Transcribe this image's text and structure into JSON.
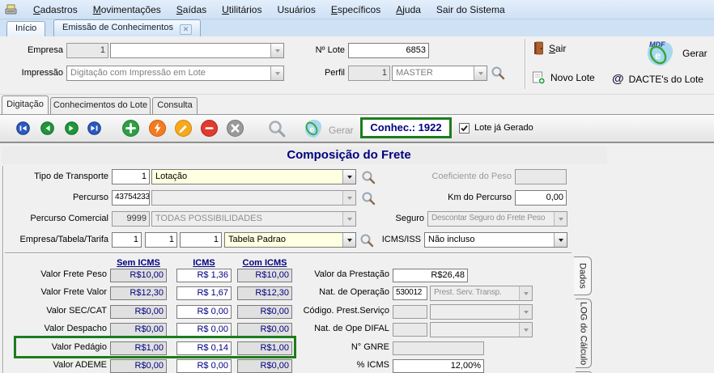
{
  "menubar": {
    "items": [
      "Cadastros",
      "Movimentações",
      "Saídas",
      "Utilitários",
      "Usuários",
      "Específicos",
      "Ajuda",
      "Sair do Sistema"
    ]
  },
  "tabs": {
    "inicio": "Início",
    "emissao": "Emissão de Conhecimentos",
    "close_glyph": "✕"
  },
  "header": {
    "empresa_label": "Empresa",
    "empresa_code": "1",
    "empresa_name": "",
    "impressao_label": "Impressão",
    "impressao_value": "Digitação com Impressão em Lote",
    "lote_label": "Nº Lote",
    "lote_value": "6853",
    "perfil_label": "Perfil",
    "perfil_code": "1",
    "perfil_value": "MASTER",
    "sair_label": "Sair",
    "novo_lote_label": "Novo Lote",
    "gerar_label": "Gerar",
    "dacte_label": "DACTE's do Lote",
    "dacte_glyph": "@"
  },
  "subtabs": {
    "digitacao": "Digitação",
    "conhecimentos": "Conhecimentos do Lote",
    "consulta": "Consulta"
  },
  "toolbar": {
    "icons": [
      "first-record",
      "previous-record",
      "next-record",
      "last-record",
      "add",
      "generate-bolt",
      "edit",
      "delete",
      "cancel",
      "search",
      "cte-logo"
    ],
    "gerar_label": "Gerar",
    "conhec_value": "Conhec.: 1922",
    "lote_gerado_label": "Lote já Gerado",
    "lote_gerado_checked": true
  },
  "freight": {
    "title": "Composição do Frete",
    "tipo_transporte_label": "Tipo de Transporte",
    "tipo_transporte_code": "1",
    "tipo_transporte_value": "Lotação",
    "percurso_label": "Percurso",
    "percurso_code": "43754233",
    "percurso_value": "",
    "percurso_comercial_label": "Percurso Comercial",
    "percurso_comercial_code": "9999",
    "percurso_comercial_value": "TODAS POSSIBILIDADES",
    "ett_label": "Empresa/Tabela/Tarifa",
    "ett_empresa": "1",
    "ett_tabela": "1",
    "ett_tarifa": "1",
    "ett_value": "Tabela Padrao",
    "coeficiente_label": "Coeficiente do Peso",
    "coeficiente_value": "",
    "km_label": "Km do Percurso",
    "km_value": "0,00",
    "seguro_label": "Seguro",
    "seguro_value": "Descontar Seguro do Frete Peso",
    "icms_iss_label": "ICMS/ISS",
    "icms_iss_value": "Não incluso"
  },
  "values_table": {
    "columns": [
      "Sem ICMS",
      "ICMS",
      "Com ICMS"
    ],
    "rows": [
      {
        "label": "Valor Frete Peso",
        "sem": "R$10,00",
        "icms": "R$ 1,36",
        "com": "R$10,00"
      },
      {
        "label": "Valor Frete Valor",
        "sem": "R$12,30",
        "icms": "R$ 1,67",
        "com": "R$12,30"
      },
      {
        "label": "Valor SEC/CAT",
        "sem": "R$0,00",
        "icms": "R$ 0,00",
        "com": "R$0,00"
      },
      {
        "label": "Valor Despacho",
        "sem": "R$0,00",
        "icms": "R$ 0,00",
        "com": "R$0,00"
      },
      {
        "label": "Valor Pedágio",
        "sem": "R$1,00",
        "icms": "R$ 0,14",
        "com": "R$1,00",
        "highlighted": true
      },
      {
        "label": "Valor ADEME",
        "sem": "R$0,00",
        "icms": "R$ 0,00",
        "com": "R$0,00"
      }
    ]
  },
  "totals": {
    "prestacao_label": "Valor da Prestação",
    "prestacao_value": "R$26,48",
    "nat_operacao_label": "Nat. de Operação",
    "nat_operacao_code": "530012",
    "nat_operacao_value": "Prest. Serv. Transp.",
    "codigo_prest_label": "Código. Prest.Serviço",
    "codigo_prest_code": "",
    "codigo_prest_value": "",
    "nat_difal_label": "Nat. de Ope DIFAL",
    "nat_difal_code": "",
    "nat_difal_value": "",
    "gnre_label": "N° GNRE",
    "gnre_value": "",
    "icms_pct_label": "% ICMS",
    "icms_pct_value": "12,00%"
  },
  "side_tabs": {
    "dados": "Dados",
    "log": "LOG do Cálculo"
  },
  "colors": {
    "highlight_green": "#1c7d1c",
    "navy_text": "#000080",
    "cream_field": "#ffffe1"
  }
}
